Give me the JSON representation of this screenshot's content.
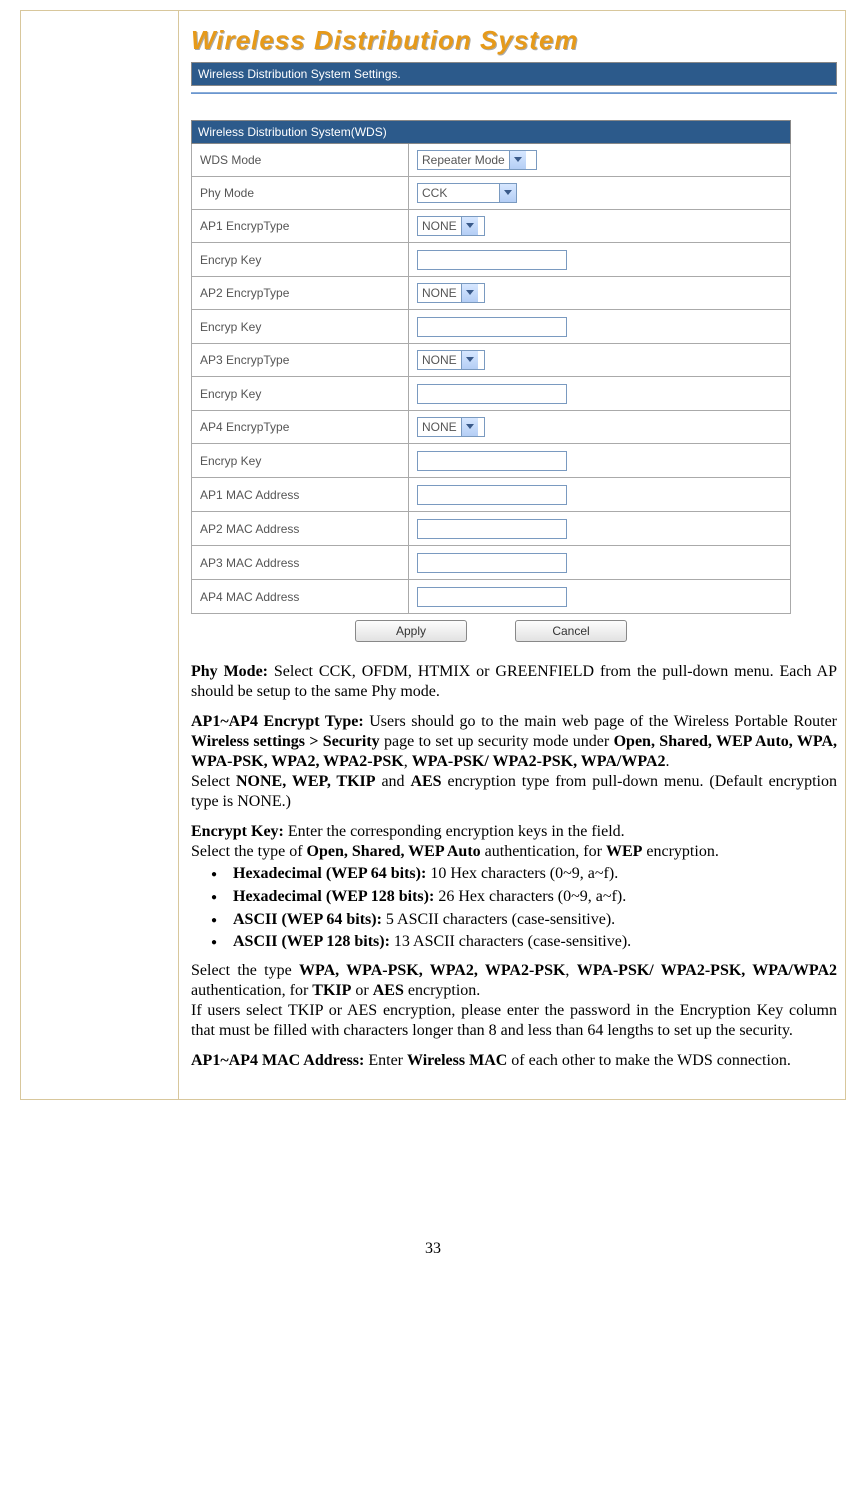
{
  "panel": {
    "title": "Wireless Distribution System",
    "subtitle": "Wireless Distribution System Settings.",
    "sectionHeader": "Wireless Distribution System(WDS)",
    "rows": {
      "wdsMode": {
        "label": "WDS Mode",
        "value": "Repeater Mode"
      },
      "phyMode": {
        "label": "Phy Mode",
        "value": "CCK"
      },
      "ap1Encrypt": {
        "label": "AP1 EncrypType",
        "value": "NONE"
      },
      "key1": {
        "label": "Encryp Key",
        "value": ""
      },
      "ap2Encrypt": {
        "label": "AP2 EncrypType",
        "value": "NONE"
      },
      "key2": {
        "label": "Encryp Key",
        "value": ""
      },
      "ap3Encrypt": {
        "label": "AP3 EncrypType",
        "value": "NONE"
      },
      "key3": {
        "label": "Encryp Key",
        "value": ""
      },
      "ap4Encrypt": {
        "label": "AP4 EncrypType",
        "value": "NONE"
      },
      "key4": {
        "label": "Encryp Key",
        "value": ""
      },
      "mac1": {
        "label": "AP1 MAC Address",
        "value": ""
      },
      "mac2": {
        "label": "AP2 MAC Address",
        "value": ""
      },
      "mac3": {
        "label": "AP3 MAC Address",
        "value": ""
      },
      "mac4": {
        "label": "AP4 MAC Address",
        "value": ""
      }
    },
    "buttons": {
      "apply": "Apply",
      "cancel": "Cancel"
    }
  },
  "doc": {
    "p1": {
      "b1": "Phy Mode: ",
      "t1": "Select CCK, OFDM, HTMIX or GREENFIELD from the pull-down menu. Each AP should be setup to the same Phy mode."
    },
    "p2": {
      "b1": "AP1~AP4 Encrypt Type: ",
      "t1": "Users should go to the main web page of the Wireless Portable Router ",
      "b2": "Wireless settings > Security",
      "t2": " page to set up security mode under ",
      "b3": "Open, Shared, WEP Auto, WPA, WPA-PSK, WPA2, WPA2-PSK",
      "t3": ", ",
      "b4": "WPA-PSK/ WPA2-PSK, WPA/WPA2",
      "t4": ".",
      "t5": "Select ",
      "b5": "NONE, WEP, TKIP",
      "t6": " and ",
      "b6": "AES",
      "t7": "  encryption type from pull-down menu. (Default encryption type is NONE.)"
    },
    "p3": {
      "b1": "Encrypt Key: ",
      "t1": "Enter the corresponding encryption keys in the field.",
      "t2": "Select the type of ",
      "b2": "Open, Shared, WEP Auto",
      "t3": " authentication, for ",
      "b3": "WEP",
      "t4": " encryption."
    },
    "bullets": {
      "i1b": "Hexadecimal (WEP 64 bits):",
      "i1t": " 10 Hex characters (0~9, a~f).",
      "i2b": "Hexadecimal (WEP 128 bits):",
      "i2t": " 26 Hex characters (0~9, a~f).",
      "i3b": "ASCII (WEP 64 bits):",
      "i3t": " 5 ASCII characters (case-sensitive).",
      "i4b": "ASCII (WEP 128 bits):",
      "i4t": " 13 ASCII characters (case-sensitive)."
    },
    "p4": {
      "t1": "Select the type ",
      "b1": "WPA, WPA-PSK, WPA2, WPA2-PSK",
      "t2": ", ",
      "b2": "WPA-PSK/ WPA2-PSK, WPA/WPA2",
      "t3": " authentication, for  ",
      "b3": "TKIP",
      "t4": " or ",
      "b4": "AES",
      "t5": " encryption.",
      "t6": "If users select TKIP or AES encryption, please enter the password in the Encryption Key column that must be filled with characters longer than 8 and less than 64 lengths to set up the security."
    },
    "p5": {
      "b1": "AP1~AP4 MAC Address: ",
      "t1": "Enter ",
      "b2": "Wireless MAC",
      "t2": " of each other to make the WDS connection."
    }
  },
  "pageNumber": "33"
}
